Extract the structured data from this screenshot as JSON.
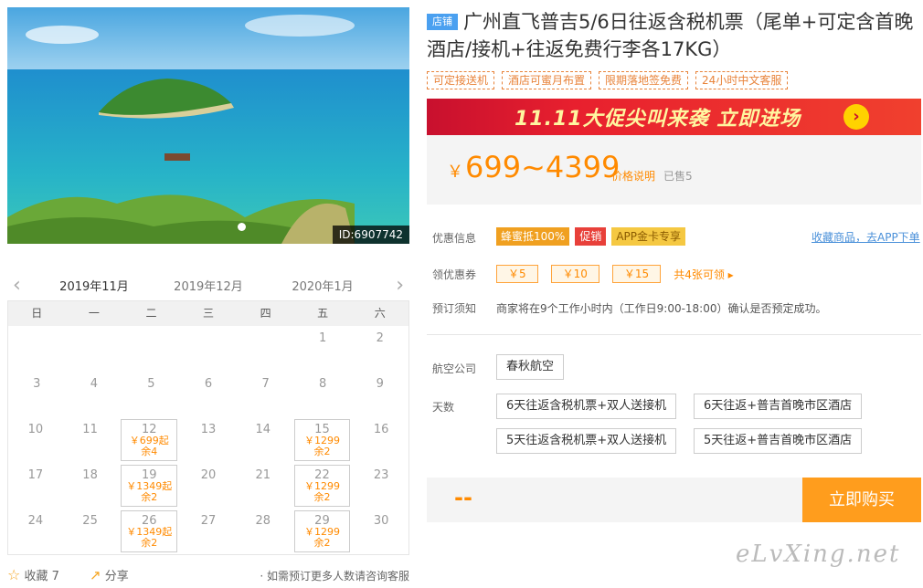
{
  "photo": {
    "id_label": "ID:6907742"
  },
  "calendar": {
    "months": [
      "2019年11月",
      "2019年12月",
      "2020年1月"
    ],
    "prev_arrow": "‹",
    "next_arrow": "›",
    "weekdays": [
      "日",
      "一",
      "二",
      "三",
      "四",
      "五",
      "六"
    ],
    "rows": [
      [
        {
          "d": ""
        },
        {
          "d": ""
        },
        {
          "d": ""
        },
        {
          "d": ""
        },
        {
          "d": ""
        },
        {
          "d": "1"
        },
        {
          "d": "2"
        }
      ],
      [
        {
          "d": "3"
        },
        {
          "d": "4"
        },
        {
          "d": "5"
        },
        {
          "d": "6"
        },
        {
          "d": "7"
        },
        {
          "d": "8"
        },
        {
          "d": "9"
        }
      ],
      [
        {
          "d": "10"
        },
        {
          "d": "11"
        },
        {
          "d": "12",
          "p": "￥699起",
          "r": "余4"
        },
        {
          "d": "13"
        },
        {
          "d": "14"
        },
        {
          "d": "15",
          "p": "￥1299",
          "r": "余2"
        },
        {
          "d": "16"
        }
      ],
      [
        {
          "d": "17"
        },
        {
          "d": "18"
        },
        {
          "d": "19",
          "p": "￥1349起",
          "r": "余2"
        },
        {
          "d": "20"
        },
        {
          "d": "21"
        },
        {
          "d": "22",
          "p": "￥1299",
          "r": "余2"
        },
        {
          "d": "23"
        }
      ],
      [
        {
          "d": "24"
        },
        {
          "d": "25"
        },
        {
          "d": "26",
          "p": "￥1349起",
          "r": "余2"
        },
        {
          "d": "27"
        },
        {
          "d": "28"
        },
        {
          "d": "29",
          "p": "￥1299",
          "r": "余2"
        },
        {
          "d": "30"
        }
      ]
    ]
  },
  "footer": {
    "fav_label": "收藏 7",
    "share_label": "分享",
    "tip": "· 如需预订更多人数请咨询客服"
  },
  "product": {
    "shop_badge": "店铺",
    "title": "广州直飞普吉5/6日往返含税机票（尾单+可定含首晚酒店/接机+往返免费行李各17KG）",
    "tags": [
      "可定接送机",
      "酒店可蜜月布置",
      "限期落地签免费",
      "24小时中文客服"
    ],
    "banner_text": "11.11大促尖叫来袭  立即进场",
    "banner_go": "›",
    "price_symbol": "￥",
    "price": "699~4399",
    "price_note": "价格说明",
    "sold": "已售5"
  },
  "info": {
    "promo_label": "优惠信息",
    "promos": [
      {
        "text": "蜂蜜抵100%",
        "color": "#f0a020"
      },
      {
        "text": "促销",
        "color": "#e8403a"
      },
      {
        "text": "APP金卡专享",
        "color": "#f5c842",
        "fg": "#8a5a00"
      }
    ],
    "app_link": "收藏商品，去APP下单",
    "coupon_label": "领优惠券",
    "coupons": [
      "￥5",
      "￥10",
      "￥15"
    ],
    "coupon_more": "共4张可领 ▸",
    "notice_label": "预订须知",
    "notice_text": "商家将在9个工作小时内（工作日9:00-18:00）确认是否预定成功。",
    "airline_label": "航空公司",
    "airline": "春秋航空",
    "days_label": "天数",
    "options": [
      "6天往返含税机票+双人送接机",
      "6天往返+普吉首晚市区酒店",
      "5天往返含税机票+双人送接机",
      "5天往返+普吉首晚市区酒店"
    ]
  },
  "buy": {
    "price_placeholder": "--",
    "button": "立即购买"
  },
  "watermark": "eLvXing.net"
}
